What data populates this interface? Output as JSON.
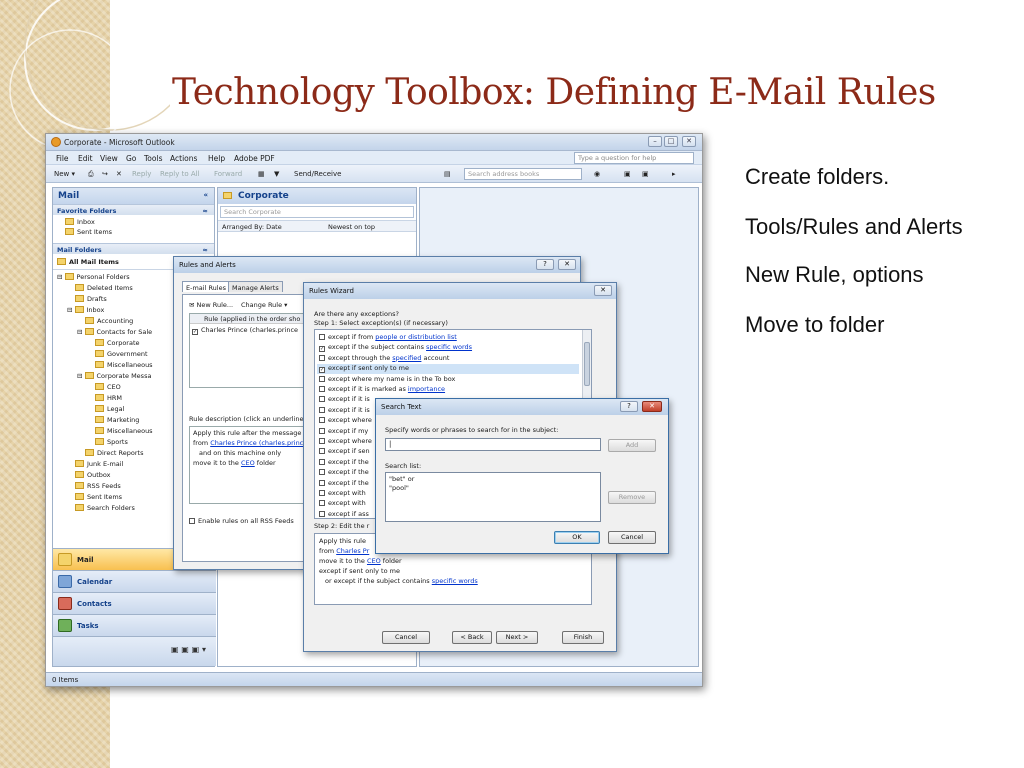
{
  "slide": {
    "title": "Technology Toolbox: Defining E-Mail Rules",
    "bullets": [
      "Create folders.",
      "Tools/Rules and Alerts",
      "New Rule, options",
      "Move to folder"
    ]
  },
  "outlook": {
    "window_title": "Corporate - Microsoft Outlook",
    "menu": [
      "File",
      "Edit",
      "View",
      "Go",
      "Tools",
      "Actions",
      "Help",
      "Adobe PDF"
    ],
    "help_placeholder": "Type a question for help",
    "toolbar": {
      "new": "New",
      "reply": "Reply",
      "reply_all": "Reply to All",
      "forward": "Forward",
      "send_receive": "Send/Receive",
      "search_placeholder": "Search address books"
    },
    "nav": {
      "header": "Mail",
      "favorites_header": "Favorite Folders",
      "favorites": [
        "Inbox",
        "Sent Items"
      ],
      "mail_folders_header": "Mail Folders",
      "all_mail": "All Mail Items",
      "folders": [
        "Personal Folders",
        "Deleted Items",
        "Drafts",
        "Inbox",
        "Accounting",
        "Contacts for Sale",
        "Corporate",
        "Government",
        "Miscellaneous",
        "Corporate Messa",
        "CEO",
        "HRM",
        "Legal",
        "Marketing",
        "Miscellaneous",
        "Sports",
        "Direct Reports",
        "Junk E-mail",
        "Outbox",
        "RSS Feeds",
        "Sent Items",
        "Search Folders"
      ],
      "buttons": [
        "Mail",
        "Calendar",
        "Contacts",
        "Tasks"
      ]
    },
    "list": {
      "header": "Corporate",
      "search_placeholder": "Search Corporate",
      "arranged_by": "Arranged By: Date",
      "sort_order": "Newest on top"
    },
    "status": "0 Items"
  },
  "rules_alerts": {
    "title": "Rules and Alerts",
    "tabs": [
      "E-mail Rules",
      "Manage Alerts"
    ],
    "new_rule": "New Rule...",
    "change_rule": "Change Rule",
    "column_header": "Rule (applied in the order sho",
    "rule_row": "Charles Prince (charles.prince",
    "desc_label": "Rule description (click an underlined",
    "desc_lines": [
      "Apply this rule after the message",
      "from ",
      "Charles Prince (charles.princ",
      "and on this machine only",
      "move it to the ",
      "CEO",
      " folder"
    ],
    "rss_label": "Enable rules on all RSS Feeds"
  },
  "wizard": {
    "title": "Rules Wizard",
    "question": "Are there any exceptions?",
    "step1": "Step 1: Select exception(s) (if necessary)",
    "exceptions": [
      {
        "pre": "except if from ",
        "link": "people or distribution list",
        "checked": false
      },
      {
        "pre": "except if the subject contains ",
        "link": "specific words",
        "checked": true
      },
      {
        "pre": "except through the ",
        "link": "specified",
        "post": " account",
        "checked": false
      },
      {
        "pre": "except if sent only to me",
        "checked": true,
        "selected": true
      },
      {
        "pre": "except where my name is in the To box",
        "checked": false
      },
      {
        "pre": "except if it is marked as ",
        "link": "importance",
        "checked": false
      },
      {
        "pre": "except if it is",
        "checked": false
      },
      {
        "pre": "except if it is",
        "checked": false
      },
      {
        "pre": "except where",
        "checked": false
      },
      {
        "pre": "except if my",
        "checked": false
      },
      {
        "pre": "except where",
        "checked": false
      },
      {
        "pre": "except if sen",
        "checked": false
      },
      {
        "pre": "except if the",
        "checked": false
      },
      {
        "pre": "except if the",
        "checked": false
      },
      {
        "pre": "except if the",
        "checked": false
      },
      {
        "pre": "except with",
        "checked": false
      },
      {
        "pre": "except with",
        "checked": false
      },
      {
        "pre": "except if ass",
        "checked": false
      }
    ],
    "step2": "Step 2: Edit the r",
    "desc_lines": [
      "Apply this rule",
      "from ",
      "Charles Pr",
      "move it to the ",
      "CEO",
      " folder",
      "except if sent only to me",
      "or except if the subject contains ",
      "specific words"
    ],
    "buttons": [
      "Cancel",
      "< Back",
      "Next >",
      "Finish"
    ]
  },
  "search_text": {
    "title": "Search Text",
    "prompt": "Specify words or phrases to search for in the subject:",
    "input_value": "|",
    "add": "Add",
    "list_label": "Search list:",
    "list_items": [
      "\"bet\" or",
      "\"pool\""
    ],
    "remove": "Remove",
    "ok": "OK",
    "cancel": "Cancel"
  }
}
